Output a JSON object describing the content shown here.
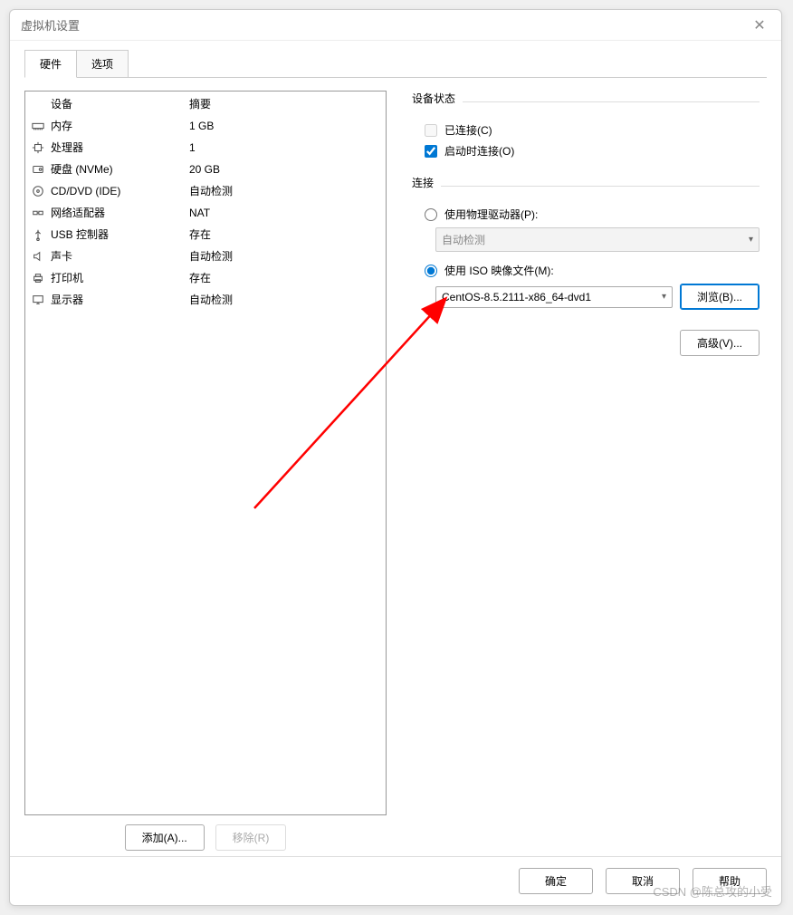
{
  "window": {
    "title": "虚拟机设置"
  },
  "tabs": {
    "hardware": "硬件",
    "options": "选项"
  },
  "device_table": {
    "header_name": "设备",
    "header_summary": "摘要",
    "rows": [
      {
        "icon": "memory",
        "name": "内存",
        "summary": "1 GB"
      },
      {
        "icon": "cpu",
        "name": "处理器",
        "summary": "1"
      },
      {
        "icon": "disk",
        "name": "硬盘 (NVMe)",
        "summary": "20 GB"
      },
      {
        "icon": "cd",
        "name": "CD/DVD (IDE)",
        "summary": "自动检测"
      },
      {
        "icon": "net",
        "name": "网络适配器",
        "summary": "NAT"
      },
      {
        "icon": "usb",
        "name": "USB 控制器",
        "summary": "存在"
      },
      {
        "icon": "sound",
        "name": "声卡",
        "summary": "自动检测"
      },
      {
        "icon": "printer",
        "name": "打印机",
        "summary": "存在"
      },
      {
        "icon": "display",
        "name": "显示器",
        "summary": "自动检测"
      }
    ]
  },
  "left_buttons": {
    "add": "添加(A)...",
    "remove": "移除(R)"
  },
  "right": {
    "device_state": {
      "title": "设备状态",
      "connected": "已连接(C)",
      "connect_on_start": "启动时连接(O)"
    },
    "connection": {
      "title": "连接",
      "use_physical": "使用物理驱动器(P):",
      "auto_detect": "自动检测",
      "use_iso": "使用 ISO 映像文件(M):",
      "iso_value": "CentOS-8.5.2111-x86_64-dvd1",
      "browse": "浏览(B)..."
    },
    "advanced": "高级(V)..."
  },
  "footer": {
    "ok": "确定",
    "cancel": "取消",
    "help": "帮助"
  },
  "watermark": "CSDN @陈总攻的小受"
}
